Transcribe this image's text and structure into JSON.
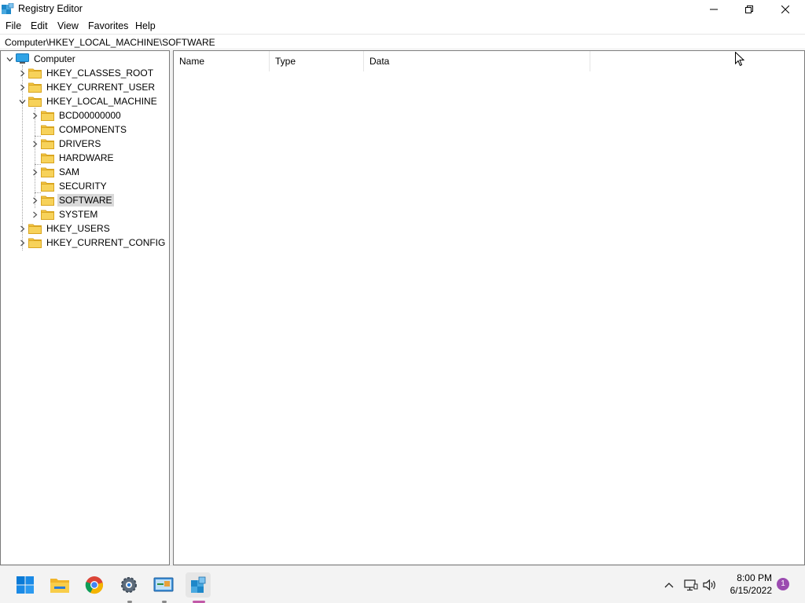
{
  "window": {
    "title": "Registry Editor",
    "icon": "registry-editor-icon"
  },
  "menu": [
    "File",
    "Edit",
    "View",
    "Favorites",
    "Help"
  ],
  "address": "Computer\\HKEY_LOCAL_MACHINE\\SOFTWARE",
  "tree": {
    "root": "Computer",
    "hives": [
      {
        "label": "HKEY_CLASSES_ROOT",
        "expanded": false
      },
      {
        "label": "HKEY_CURRENT_USER",
        "expanded": false
      },
      {
        "label": "HKEY_LOCAL_MACHINE",
        "expanded": true,
        "children": [
          {
            "label": "BCD00000000",
            "has_children": true
          },
          {
            "label": "COMPONENTS",
            "has_children": false
          },
          {
            "label": "DRIVERS",
            "has_children": true
          },
          {
            "label": "HARDWARE",
            "has_children": false
          },
          {
            "label": "SAM",
            "has_children": true
          },
          {
            "label": "SECURITY",
            "has_children": false
          },
          {
            "label": "SOFTWARE",
            "has_children": true,
            "selected": true
          },
          {
            "label": "SYSTEM",
            "has_children": true
          }
        ]
      },
      {
        "label": "HKEY_USERS",
        "expanded": false
      },
      {
        "label": "HKEY_CURRENT_CONFIG",
        "expanded": false
      }
    ]
  },
  "list": {
    "columns": [
      "Name",
      "Type",
      "Data"
    ]
  },
  "taskbar": {
    "apps": [
      "start-icon",
      "file-explorer-icon",
      "chrome-icon",
      "settings-icon",
      "control-panel-icon",
      "registry-editor-icon"
    ],
    "clock_time": "8:00 PM",
    "clock_date": "6/15/2022",
    "notification_count": "1"
  },
  "colors": {
    "accent": "#0078d4",
    "folder": "#f4c542",
    "selection": "#d9d9d9",
    "taskbar": "#f3f3f3"
  }
}
